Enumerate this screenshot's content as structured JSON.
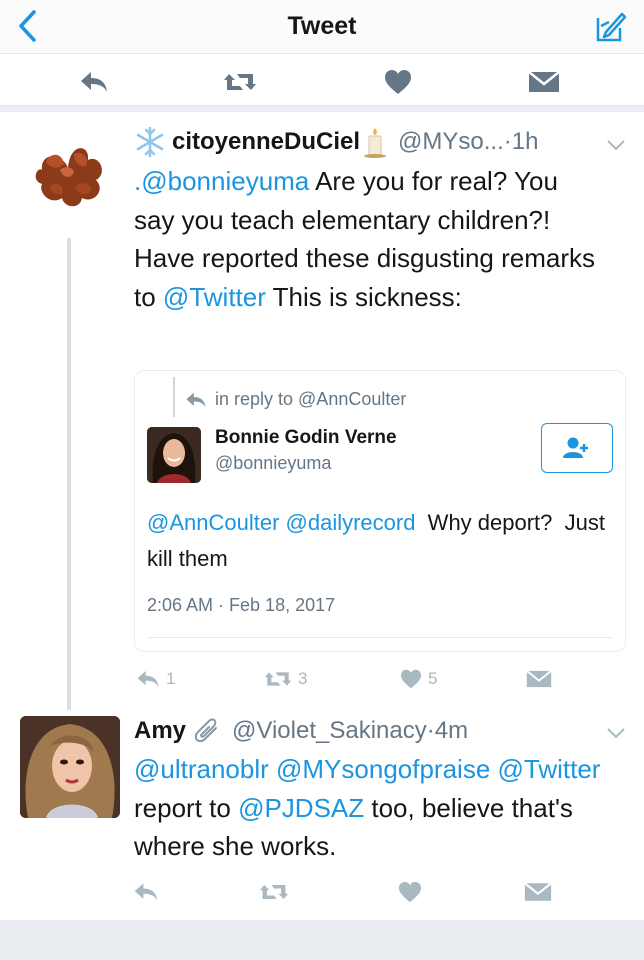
{
  "header": {
    "title": "Tweet",
    "back_icon": "back-chevron-icon",
    "compose_icon": "compose-icon",
    "accent": "#1b95e0"
  },
  "tweet1": {
    "display_name": "citoyenneDuCiel",
    "handle": "@MYso...",
    "separator": " · ",
    "time": "1h",
    "text": {
      "mention": ".@bonnieyuma",
      "part1": " Are you for real? You say you teach elementary children?! Have reported these disgusting remarks to ",
      "mention2": "@Twitter",
      "part2": " This is sickness:"
    },
    "stats": {
      "replies": "1",
      "retweets": "3",
      "likes": "5"
    }
  },
  "quote": {
    "reply_to": "in reply to @AnnCoulter",
    "name": "Bonnie Godin Verne",
    "handle": "@bonnieyuma",
    "text_mentions": "@AnnCoulter @dailyrecord",
    "text_rest": "  Why deport?  Just kill them",
    "date": "2:06 AM · Feb 18, 2017"
  },
  "tweet2": {
    "display_name": "Amy",
    "handle": "@Violet_Sakinacy",
    "separator": " · ",
    "time": "4m",
    "text": {
      "mentions": "@ultranoblr @MYsongofpraise @Twitter",
      "part1": " report to ",
      "mention2": "@PJDSAZ",
      "part2": " too, believe that's where she works."
    }
  }
}
